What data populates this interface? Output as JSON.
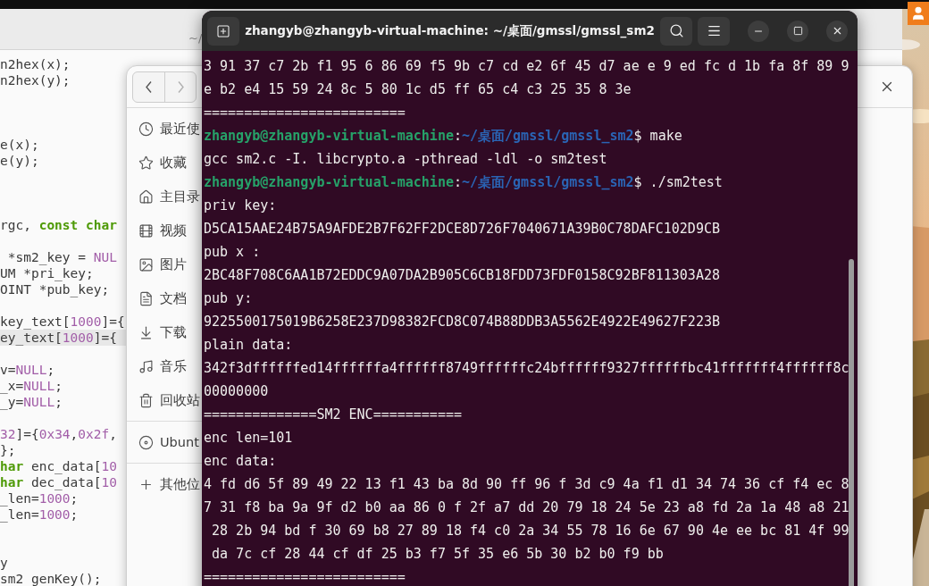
{
  "editor": {
    "title": "~/",
    "lines": [
      {
        "kind": "code",
        "highlighted": false,
        "segments": [
          {
            "text": "n2hex(x);",
            "kind": "plain"
          }
        ]
      },
      {
        "kind": "code",
        "highlighted": false,
        "segments": [
          {
            "text": "n2hex(y);",
            "kind": "plain"
          }
        ]
      },
      {
        "kind": "blank"
      },
      {
        "kind": "blank"
      },
      {
        "kind": "blank"
      },
      {
        "kind": "code",
        "highlighted": false,
        "segments": [
          {
            "text": "e(x);",
            "kind": "plain"
          }
        ]
      },
      {
        "kind": "code",
        "highlighted": false,
        "segments": [
          {
            "text": "e(y);",
            "kind": "plain"
          }
        ]
      },
      {
        "kind": "blank"
      },
      {
        "kind": "blank"
      },
      {
        "kind": "blank"
      },
      {
        "kind": "code",
        "highlighted": false,
        "segments": [
          {
            "text": "rgc, ",
            "kind": "plain"
          },
          {
            "text": "const char",
            "kind": "keyword"
          }
        ]
      },
      {
        "kind": "blank"
      },
      {
        "kind": "code",
        "highlighted": false,
        "segments": [
          {
            "text": " *sm2_key = ",
            "kind": "plain"
          },
          {
            "text": "NUL",
            "kind": "literal"
          }
        ]
      },
      {
        "kind": "code",
        "highlighted": false,
        "segments": [
          {
            "text": "UM *pri_key;",
            "kind": "plain"
          }
        ]
      },
      {
        "kind": "code",
        "highlighted": false,
        "segments": [
          {
            "text": "OINT *pub_key;",
            "kind": "plain"
          }
        ]
      },
      {
        "kind": "blank"
      },
      {
        "kind": "code",
        "highlighted": false,
        "segments": [
          {
            "text": "key_text[",
            "kind": "plain"
          },
          {
            "text": "1000",
            "kind": "literal"
          },
          {
            "text": "]={",
            "kind": "plain"
          }
        ]
      },
      {
        "kind": "code",
        "highlighted": true,
        "segments": [
          {
            "text": "ey_text[",
            "kind": "plain"
          },
          {
            "text": "1000",
            "kind": "literal"
          },
          {
            "text": "]={",
            "kind": "plain"
          }
        ]
      },
      {
        "kind": "blank"
      },
      {
        "kind": "code",
        "highlighted": false,
        "segments": [
          {
            "text": "v=",
            "kind": "plain"
          },
          {
            "text": "NULL",
            "kind": "literal"
          },
          {
            "text": ";",
            "kind": "plain"
          }
        ]
      },
      {
        "kind": "code",
        "highlighted": false,
        "segments": [
          {
            "text": "_x=",
            "kind": "plain"
          },
          {
            "text": "NULL",
            "kind": "literal"
          },
          {
            "text": ";",
            "kind": "plain"
          }
        ]
      },
      {
        "kind": "code",
        "highlighted": false,
        "segments": [
          {
            "text": "_y=",
            "kind": "plain"
          },
          {
            "text": "NULL",
            "kind": "literal"
          },
          {
            "text": ";",
            "kind": "plain"
          }
        ]
      },
      {
        "kind": "blank"
      },
      {
        "kind": "code",
        "highlighted": false,
        "segments": [
          {
            "text": "32",
            "kind": "literal"
          },
          {
            "text": "]={",
            "kind": "plain"
          },
          {
            "text": "0x34",
            "kind": "literal"
          },
          {
            "text": ",",
            "kind": "plain"
          },
          {
            "text": "0x2f",
            "kind": "literal"
          },
          {
            "text": ",",
            "kind": "plain"
          }
        ]
      },
      {
        "kind": "code",
        "highlighted": false,
        "segments": [
          {
            "text": "};",
            "kind": "plain"
          }
        ]
      },
      {
        "kind": "code",
        "highlighted": false,
        "segments": [
          {
            "text": "har",
            "kind": "keyword"
          },
          {
            "text": " enc_data[",
            "kind": "plain"
          },
          {
            "text": "10",
            "kind": "literal"
          }
        ]
      },
      {
        "kind": "code",
        "highlighted": false,
        "segments": [
          {
            "text": "har",
            "kind": "keyword"
          },
          {
            "text": " dec_data[",
            "kind": "plain"
          },
          {
            "text": "10",
            "kind": "literal"
          }
        ]
      },
      {
        "kind": "code",
        "highlighted": false,
        "segments": [
          {
            "text": "_len=",
            "kind": "plain"
          },
          {
            "text": "1000",
            "kind": "literal"
          },
          {
            "text": ";",
            "kind": "plain"
          }
        ]
      },
      {
        "kind": "code",
        "highlighted": false,
        "segments": [
          {
            "text": "_len=",
            "kind": "plain"
          },
          {
            "text": "1000",
            "kind": "literal"
          },
          {
            "text": ";",
            "kind": "plain"
          }
        ]
      },
      {
        "kind": "blank"
      },
      {
        "kind": "blank"
      },
      {
        "kind": "code",
        "highlighted": false,
        "segments": [
          {
            "text": "y",
            "kind": "plain"
          }
        ]
      },
      {
        "kind": "code",
        "highlighted": false,
        "segments": [
          {
            "text": "sm2_genKey();",
            "kind": "plain"
          }
        ]
      }
    ]
  },
  "file_manager": {
    "sections": [
      {
        "items": [
          {
            "label": "最近使"
          },
          {
            "label": "收藏"
          },
          {
            "label": "主目录"
          },
          {
            "label": "视频"
          },
          {
            "label": "图片"
          },
          {
            "label": "文档"
          },
          {
            "label": "下载"
          },
          {
            "label": "音乐"
          },
          {
            "label": "回收站"
          }
        ]
      },
      {
        "items": [
          {
            "label": "Ubunt"
          }
        ]
      },
      {
        "items": [
          {
            "label": "其他位"
          }
        ]
      }
    ]
  },
  "terminal": {
    "title": "zhangyb@zhangyb-virtual-machine: ~/桌面/gmssl/gmssl_sm2",
    "lines": [
      {
        "kind": "output",
        "text": "3 91 37 c7 2b f1 95 6 86 69 f5 9b c7 cd e2 6f 45 d7 ae e 9 ed fc d 1b fa 8f 89 9"
      },
      {
        "kind": "output",
        "text": "e b2 e4 15 59 24 8c 5 80 1c d5 ff 65 c4 c3 25 35 8 3e"
      },
      {
        "kind": "output",
        "text": "========================="
      },
      {
        "kind": "prompt",
        "user": "zhangyb@zhangyb-virtual-machine",
        "colon": ":",
        "path": "~/桌面/gmssl/gmssl_sm2",
        "command": "$ make"
      },
      {
        "kind": "output",
        "text": "gcc sm2.c -I. libcrypto.a -pthread -ldl -o sm2test"
      },
      {
        "kind": "prompt",
        "user": "zhangyb@zhangyb-virtual-machine",
        "colon": ":",
        "path": "~/桌面/gmssl/gmssl_sm2",
        "command": "$ ./sm2test"
      },
      {
        "kind": "output",
        "text": "priv key:"
      },
      {
        "kind": "output",
        "text": "D5CA15AAE24B75A9AFDE2B7F62FF2DCE8D726F7040671A39B0C78DAFC102D9CB"
      },
      {
        "kind": "output",
        "text": "pub x :"
      },
      {
        "kind": "output",
        "text": "2BC48F708C6AA1B72EDDC9A07DA2B905C6CB18FDD73FDF0158C92BF811303A28"
      },
      {
        "kind": "output",
        "text": "pub y:"
      },
      {
        "kind": "output",
        "text": "9225500175019B6258E237D98382FCD8C074B88DDB3A5562E4922E49627F223B"
      },
      {
        "kind": "output",
        "text": "plain data:"
      },
      {
        "kind": "output",
        "text": "342f3dffffffed14ffffffa4ffffff8749ffffffc24bffffff9327ffffffbc41fffffff4ffffff8c"
      },
      {
        "kind": "output",
        "text": "00000000"
      },
      {
        "kind": "output",
        "text": "==============SM2 ENC==========="
      },
      {
        "kind": "output",
        "text": "enc len=101"
      },
      {
        "kind": "output",
        "text": "enc data:"
      },
      {
        "kind": "output",
        "text": "4 fd d6 5f 89 49 22 13 f1 43 ba 8d 90 ff 96 f 3d c9 4a f1 d1 34 74 36 cf f4 ec 8"
      },
      {
        "kind": "output",
        "text": "7 31 f8 ba 9a 9f d2 b0 aa 86 0 f 2f a7 dd 20 79 18 24 5e 23 a8 fd 2a 1a 48 a8 21"
      },
      {
        "kind": "output",
        "text": " 28 2b 94 bd f 30 69 b8 27 89 18 f4 c0 2a 34 55 78 16 6e 67 90 4e ee bc 81 4f 99"
      },
      {
        "kind": "output",
        "text": " da 7c cf 28 44 cf df 25 b3 f7 5f 35 e6 5b 30 b2 b0 f9 bb"
      },
      {
        "kind": "output",
        "text": "========================="
      }
    ]
  }
}
